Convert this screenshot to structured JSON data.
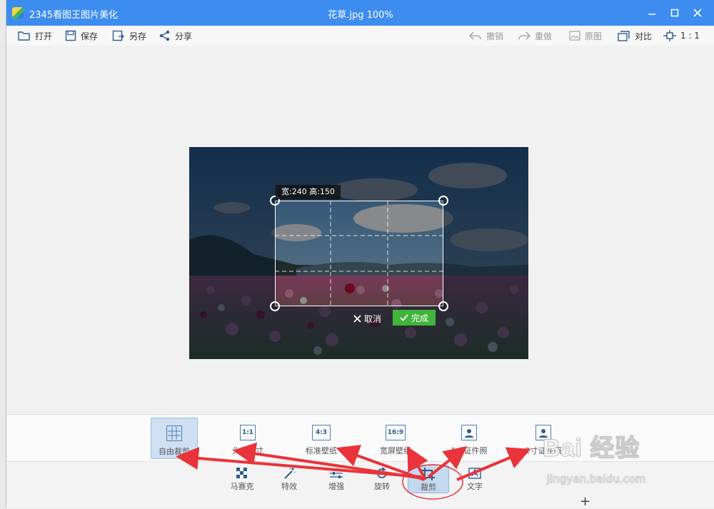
{
  "window": {
    "app_name": "2345看图王图片美化",
    "title": "花草.jpg  100%",
    "controls": [
      "minimize-icon",
      "maximize-icon",
      "close-icon"
    ]
  },
  "toolbar": {
    "open": "打开",
    "save": "保存",
    "save_as": "另存",
    "share": "分享",
    "undo": "撤销",
    "redo": "重做",
    "original": "原图",
    "compare": "对比",
    "ratio": "1 : 1"
  },
  "crop": {
    "size_label": "宽:240  高:150",
    "cancel_label": "取消",
    "done_label": "完成"
  },
  "crop_options": [
    {
      "icon": "grid-icon",
      "label": "自由裁剪",
      "active": true
    },
    {
      "icon_text": "1:1",
      "label": "头像尺寸"
    },
    {
      "icon_text": "4:3",
      "label": "标准壁纸"
    },
    {
      "icon_text": "16:9",
      "label": "宽屏壁纸"
    },
    {
      "icon": "person-id-icon",
      "label": "1寸证件照"
    },
    {
      "icon": "person-id-icon",
      "label": "2寸证件照"
    }
  ],
  "tools": [
    {
      "icon": "mosaic-icon",
      "label": "马赛克"
    },
    {
      "icon": "magic-wand-icon",
      "label": "特效"
    },
    {
      "icon": "sliders-icon",
      "label": "增强"
    },
    {
      "icon": "rotate-icon",
      "label": "旋转"
    },
    {
      "icon": "crop-icon",
      "label": "裁剪",
      "active": true
    },
    {
      "icon": "text-icon",
      "label": "文字"
    }
  ],
  "watermark": {
    "logo": "Bai 经验",
    "url": "jingyan.baidu.com"
  },
  "colors": {
    "titlebar": "#3d8df0",
    "done_button": "#41b43b",
    "annotation": "#e8343a"
  }
}
